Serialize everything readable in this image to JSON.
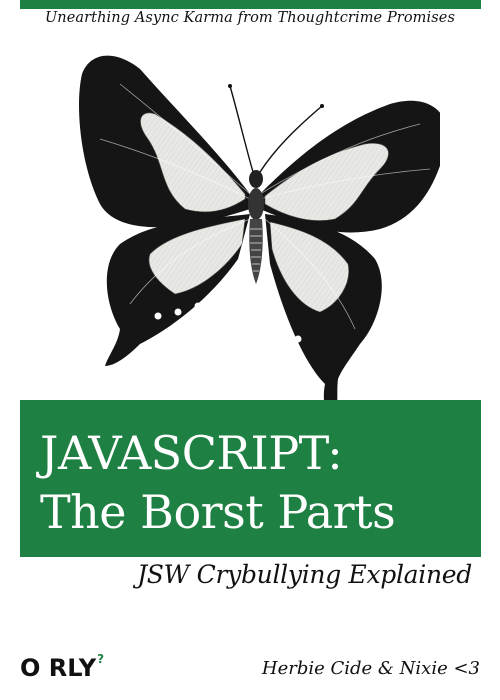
{
  "cover": {
    "tagline": "Unearthing Async Karma from Thoughtcrime Promises",
    "title_line1": "JAVASCRIPT:",
    "title_line2": "The Borst Parts",
    "subtitle": "JSW Crybullying Explained",
    "publisher": "O RLY",
    "publisher_mark": "?",
    "author": "Herbie Cide & Nixie <3"
  },
  "illustration": {
    "subject": "butterfly-icon"
  },
  "colors": {
    "brand_green": "#1e8043",
    "ink": "#111111",
    "wing_light": "#e8e8e4",
    "background": "#ffffff"
  }
}
